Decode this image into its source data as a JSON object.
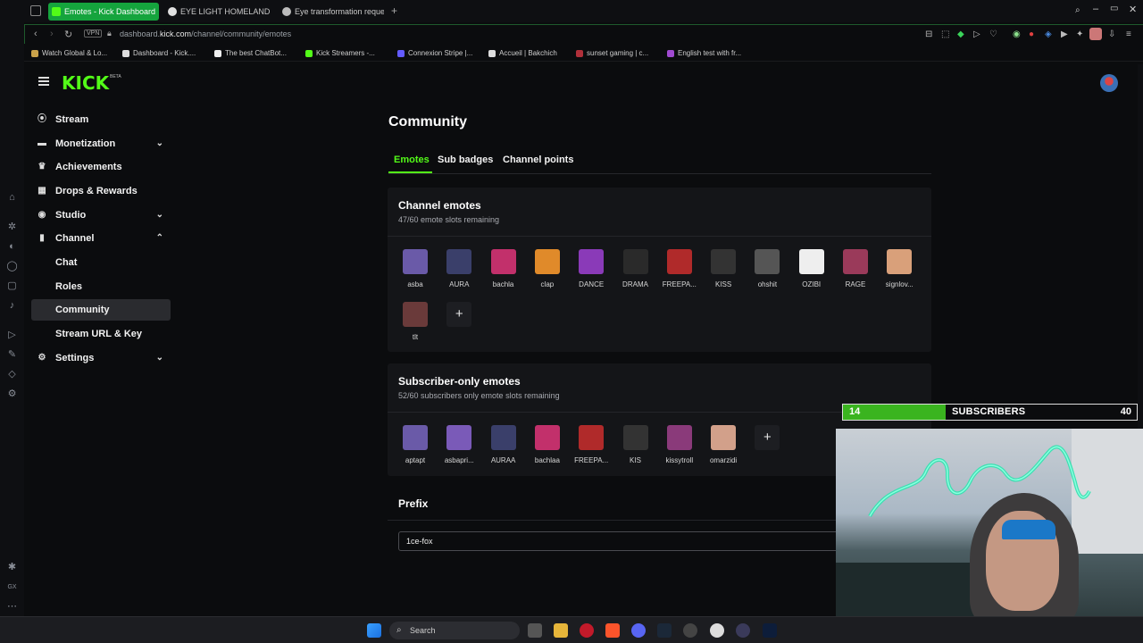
{
  "browser": {
    "tabs": [
      {
        "label": "Emotes - Kick Dashboard",
        "active": true
      },
      {
        "label": "EYE LIGHT HOMELANDE"
      },
      {
        "label": "Eye transformation reque"
      }
    ],
    "new_tab": "+",
    "url_host": "dashboard.kick.com",
    "url_path": "/channel/community/emotes",
    "url_prefix": "dashboard.",
    "url_domain": "kick.com",
    "vpn": "VPN",
    "bookmarks": [
      "Watch Global & Lo...",
      "Dashboard - Kick....",
      "The best ChatBot...",
      "Kick Streamers -...",
      "Connexion Stripe |...",
      "Accueil | Bakchich",
      "sunset gaming | c...",
      "English test with fr..."
    ]
  },
  "header": {
    "logo": "KICK",
    "beta": "BETA"
  },
  "sidebar": {
    "items": [
      {
        "label": "Stream",
        "icon": "broadcast-icon"
      },
      {
        "label": "Monetization",
        "icon": "money-icon",
        "chevron": "down"
      },
      {
        "label": "Achievements",
        "icon": "trophy-icon"
      },
      {
        "label": "Drops & Rewards",
        "icon": "gift-icon"
      },
      {
        "label": "Studio",
        "icon": "studio-icon",
        "chevron": "down"
      },
      {
        "label": "Channel",
        "icon": "channel-icon",
        "chevron": "up"
      },
      {
        "label": "Chat"
      },
      {
        "label": "Roles"
      },
      {
        "label": "Community",
        "active": true
      },
      {
        "label": "Stream URL & Key"
      },
      {
        "label": "Settings",
        "icon": "gear-icon",
        "chevron": "down"
      }
    ]
  },
  "main": {
    "title": "Community",
    "tabs": [
      "Emotes",
      "Sub badges",
      "Channel points"
    ],
    "channel_emotes": {
      "title": "Channel emotes",
      "subtitle": "47/60 emote slots remaining",
      "emotes": [
        "asba",
        "AURA",
        "bachla",
        "clap",
        "DANCE",
        "DRAMA",
        "FREEPA...",
        "KISS",
        "ohshit",
        "OZIBI",
        "RAGE",
        "signlov...",
        "tlt"
      ],
      "colors": [
        "#6a5aa8",
        "#3a3f6a",
        "#c2306b",
        "#e08a2a",
        "#8a3ab8",
        "#2a2a2a",
        "#b02a2a",
        "#333333",
        "#555555",
        "#eeeeee",
        "#9a3a5a",
        "#d9a07a",
        "#6a3a3a"
      ]
    },
    "sub_emotes": {
      "title": "Subscriber-only emotes",
      "subtitle": "52/60 subscribers only emote slots remaining",
      "emotes": [
        "aptapt",
        "asbapri...",
        "AURAA",
        "bachlaa",
        "FREEPA...",
        "KIS",
        "kissytroll",
        "omarzidi"
      ],
      "colors": [
        "#6a5aa8",
        "#7a5ab8",
        "#3a3f6a",
        "#c2306b",
        "#b02a2a",
        "#333333",
        "#8a3a7a",
        "#d2a08a"
      ]
    },
    "add": "+",
    "prefix": {
      "title": "Prefix",
      "value": "1ce-fox"
    }
  },
  "overlay": {
    "current": "14",
    "label": "SUBSCRIBERS",
    "goal": "40",
    "fill_fraction": 0.35
  },
  "taskbar": {
    "search": "Search"
  }
}
